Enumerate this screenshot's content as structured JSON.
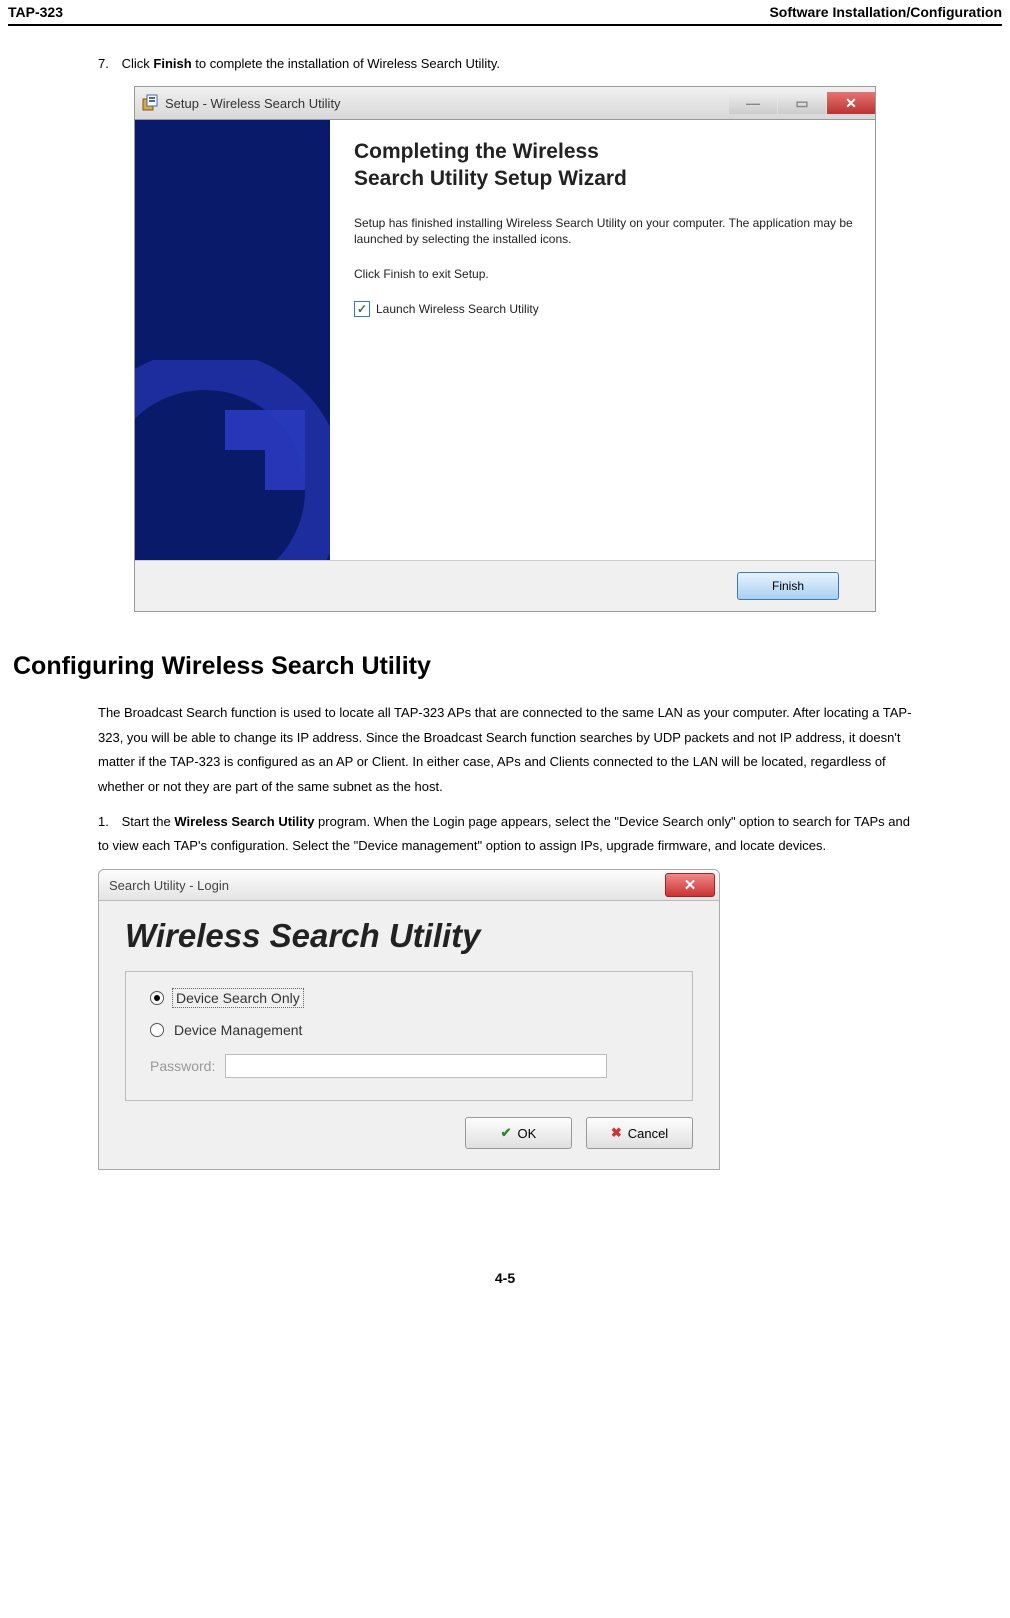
{
  "header": {
    "left": "TAP-323",
    "right": "Software Installation/Configuration"
  },
  "step7": {
    "num": "7.",
    "prefix": "Click ",
    "bold": "Finish",
    "suffix": " to complete the installation of Wireless Search Utility."
  },
  "wizard": {
    "title": "Setup - Wireless Search Utility",
    "heading_l1": "Completing the Wireless",
    "heading_l2": "Search Utility Setup Wizard",
    "para1": "Setup has finished installing Wireless Search Utility on your computer. The application may be launched by selecting the installed icons.",
    "para2": "Click Finish to exit Setup.",
    "checkbox_label": "Launch Wireless Search Utility",
    "finish": "Finish"
  },
  "section_heading": "Configuring Wireless Search Utility",
  "intro_para": "The Broadcast Search function is used to locate all TAP-323 APs that are connected to the same LAN as your computer. After locating a TAP-323, you will be able to change its IP address. Since the Broadcast Search function searches by UDP packets and not IP address, it doesn't matter if the TAP-323 is configured as an AP or Client. In either case, APs and Clients connected to the LAN will be located, regardless of whether or not they are part of the same subnet as the host.",
  "step1": {
    "num": "1.",
    "prefix": "Start the ",
    "bold": "Wireless Search Utility",
    "suffix": " program. When the Login page appears, select the \"Device Search only\" option to search for TAPs and to view each TAP's configuration. Select the \"Device management\" option to assign IPs, upgrade firmware, and locate devices."
  },
  "login": {
    "title": "Search Utility - Login",
    "heading": "Wireless Search Utility",
    "opt1": "Device Search Only",
    "opt2": "Device Management",
    "pwd_label": "Password:",
    "ok": "OK",
    "cancel": "Cancel"
  },
  "footer": "4-5"
}
